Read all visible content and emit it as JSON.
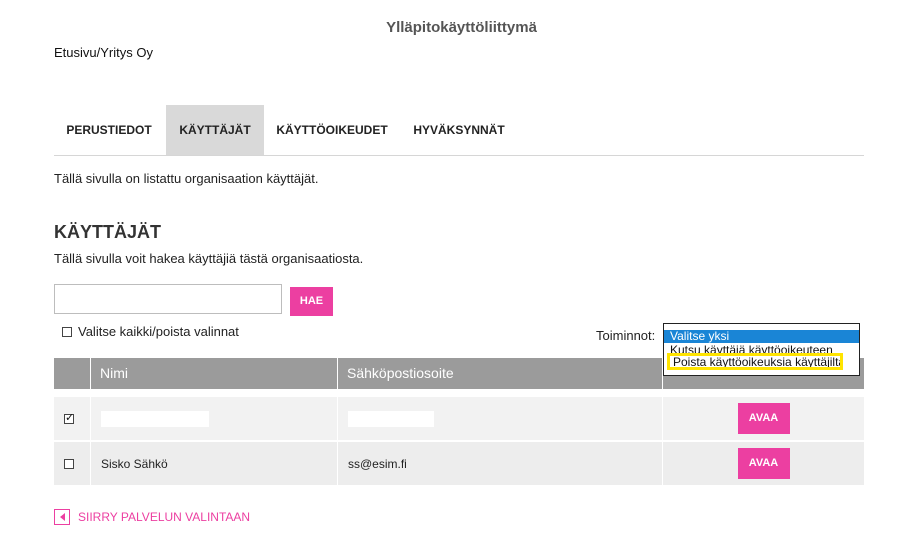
{
  "header": {
    "title": "Ylläpitokäyttöliittymä"
  },
  "breadcrumb": {
    "home": "Etusivu",
    "separator": "/",
    "org": "Yritys Oy"
  },
  "tabs": [
    {
      "label": "PERUSTIEDOT",
      "active": false
    },
    {
      "label": "KÄYTTÄJÄT",
      "active": true
    },
    {
      "label": "KÄYTTÖOIKEUDET",
      "active": false
    },
    {
      "label": "HYVÄKSYNNÄT",
      "active": false
    }
  ],
  "intro_text": "Tällä sivulla on listattu organisaation käyttäjät.",
  "section": {
    "heading": "KÄYTTÄJÄT",
    "subtitle": "Tällä sivulla voit hakea käyttäjiä tästä organisaatiosta."
  },
  "search": {
    "value": "",
    "placeholder": "",
    "button_label": "HAE"
  },
  "select_all": {
    "label": "Valitse kaikki/poista valinnat",
    "checked": false
  },
  "actions": {
    "label": "Toiminnot:",
    "options": [
      "Valitse yksi",
      "Kutsu käyttäjä käyttöoikeuteen",
      "Poista käyttöoikeuksia käyttäjiltä"
    ],
    "selected": "Valitse yksi",
    "highlighted": "Poista käyttöoikeuksia käyttäjiltä"
  },
  "table": {
    "columns": [
      "",
      "Nimi",
      "Sähköpostiosoite",
      ""
    ],
    "rows": [
      {
        "checked": true,
        "name": "",
        "email": "",
        "action": "AVAA"
      },
      {
        "checked": false,
        "name": "Sisko Sähkö",
        "email": "ss@esim.fi",
        "action": "AVAA"
      }
    ]
  },
  "footer": {
    "back_link": "SIIRRY PALVELUN VALINTAAN"
  },
  "colors": {
    "accent": "#ec3fa1",
    "table_header": "#9b9b9b",
    "active_tab": "#d9d9d9",
    "highlight": "#ffe400",
    "select_blue": "#1a85d6"
  }
}
